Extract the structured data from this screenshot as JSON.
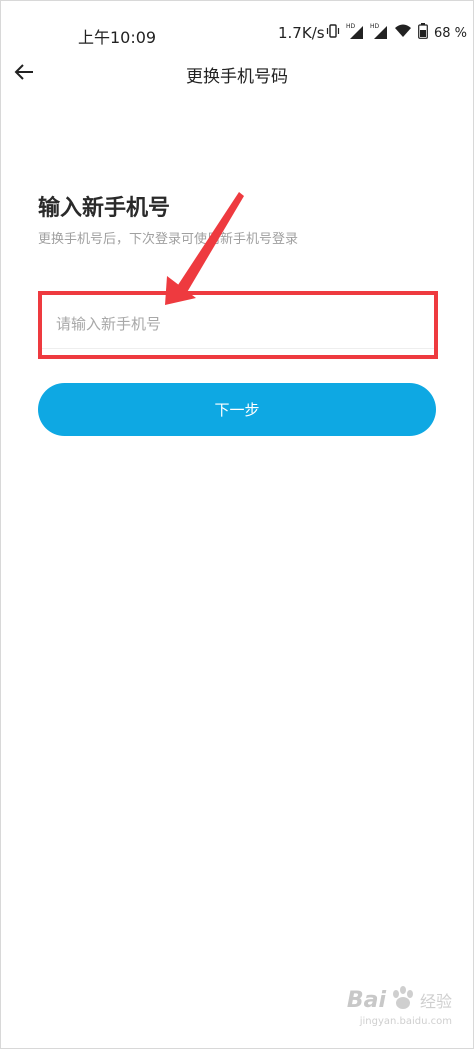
{
  "status_bar": {
    "time": "上午10:09",
    "speed": "1.7K/s",
    "battery": "68 %",
    "icons": [
      "vibrate-icon",
      "hd-signal-icon",
      "hd-signal-icon",
      "wifi-icon",
      "battery-icon"
    ]
  },
  "nav": {
    "back_icon": "arrow-left-icon",
    "title": "更换手机号码"
  },
  "content": {
    "heading": "输入新手机号",
    "subtitle": "更换手机号后，下次登录可使用新手机号登录",
    "phone_input": {
      "value": "",
      "placeholder": "请输入新手机号"
    },
    "next_button": "下一步"
  },
  "annotation": {
    "highlight_color": "#ee3a3f",
    "arrow_color": "#ee3a3f"
  },
  "colors": {
    "primary_button": "#0ea8e3",
    "heading": "#2a2a2a",
    "subtitle": "#a0a0a0"
  },
  "watermark": {
    "logo": "Bai",
    "logo_suffix": "经验",
    "url": "jingyan.baidu.com"
  }
}
